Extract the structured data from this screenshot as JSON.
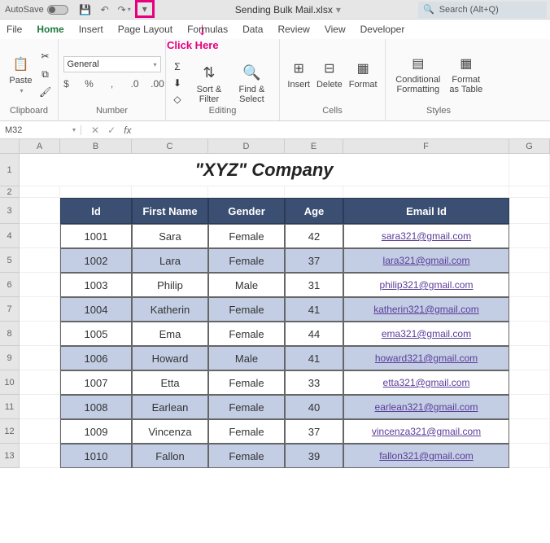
{
  "titlebar": {
    "autosave_label": "AutoSave",
    "title": "Sending Bulk Mail.xlsx",
    "search_placeholder": "Search (Alt+Q)"
  },
  "tabs": {
    "file": "File",
    "home": "Home",
    "insert": "Insert",
    "pagelayout": "Page Layout",
    "formulas": "Formulas",
    "data": "Data",
    "review": "Review",
    "view": "View",
    "developer": "Developer"
  },
  "annotation": {
    "click_here": "Click Here"
  },
  "ribbon": {
    "clipboard": {
      "label": "Clipboard",
      "paste": "Paste"
    },
    "number": {
      "label": "Number",
      "format": "General"
    },
    "editing": {
      "label": "Editing",
      "sortfilter": "Sort & Filter",
      "findselect": "Find & Select"
    },
    "cells": {
      "label": "Cells",
      "insert": "Insert",
      "delete": "Delete",
      "format": "Format"
    },
    "styles": {
      "label": "Styles",
      "conditional": "Conditional Formatting",
      "formatas": "Format as Table"
    }
  },
  "namebox": {
    "value": "M32"
  },
  "headers": [
    "A",
    "B",
    "C",
    "D",
    "E",
    "F",
    "G"
  ],
  "company_title": "\"XYZ\" Company",
  "table": {
    "headers": {
      "id": "Id",
      "first": "First Name",
      "gender": "Gender",
      "age": "Age",
      "email": "Email Id"
    },
    "rows": [
      {
        "id": "1001",
        "first": "Sara",
        "gender": "Female",
        "age": "42",
        "email": "sara321@gmail.com"
      },
      {
        "id": "1002",
        "first": "Lara",
        "gender": "Female",
        "age": "37",
        "email": "lara321@gmail.com"
      },
      {
        "id": "1003",
        "first": "Philip",
        "gender": "Male",
        "age": "31",
        "email": "philip321@gmail.com"
      },
      {
        "id": "1004",
        "first": "Katherin",
        "gender": "Female",
        "age": "41",
        "email": "katherin321@gmail.com"
      },
      {
        "id": "1005",
        "first": "Ema",
        "gender": "Female",
        "age": "44",
        "email": "ema321@gmail.com"
      },
      {
        "id": "1006",
        "first": "Howard",
        "gender": "Male",
        "age": "41",
        "email": "howard321@gmail.com"
      },
      {
        "id": "1007",
        "first": "Etta",
        "gender": "Female",
        "age": "33",
        "email": "etta321@gmail.com"
      },
      {
        "id": "1008",
        "first": "Earlean",
        "gender": "Female",
        "age": "40",
        "email": "earlean321@gmail.com"
      },
      {
        "id": "1009",
        "first": "Vincenza",
        "gender": "Female",
        "age": "37",
        "email": "vincenza321@gmail.com"
      },
      {
        "id": "1010",
        "first": "Fallon",
        "gender": "Female",
        "age": "39",
        "email": "fallon321@gmail.com"
      }
    ]
  }
}
